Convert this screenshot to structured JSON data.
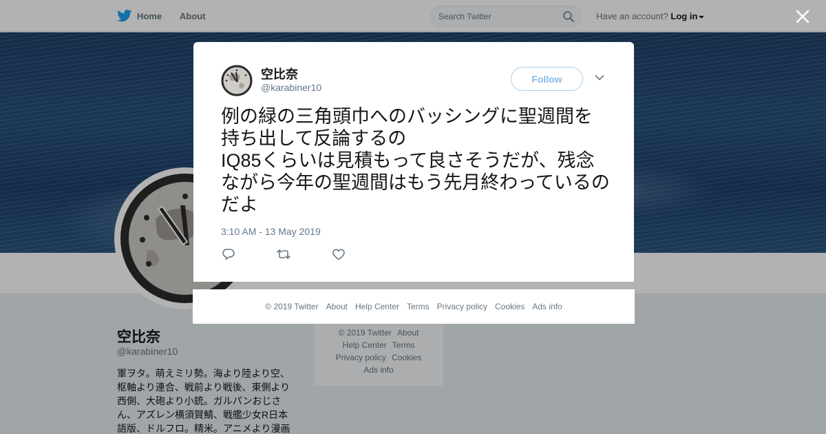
{
  "topbar": {
    "home_label": "Home",
    "about_label": "About",
    "search_placeholder": "Search Twitter",
    "account_prompt": "Have an account?",
    "login_label": "Log in"
  },
  "profile": {
    "name": "空比奈",
    "handle": "@karabiner10",
    "bio": "軍ヲタ。萌えミリ勢。海より陸より空、枢軸より連合、戦前より戦後、東側より西側、大砲より小銃。ガルパンおじさん、アズレン横須賀鯖、戦艦少女R日本語版、ドルフロ。精米。アニメより漫画"
  },
  "side_footer": {
    "row1": [
      "© 2019 Twitter",
      "About"
    ],
    "row2": [
      "Help Center",
      "Terms"
    ],
    "row3": [
      "Privacy policy",
      "Cookies"
    ],
    "row4": [
      "Ads info"
    ]
  },
  "tweet": {
    "author_name": "空比奈",
    "author_handle": "@karabiner10",
    "follow_label": "Follow",
    "text": "例の緑の三角頭巾へのバッシングに聖週間を持ち出して反論するの\nIQ85くらいは見積もって良さそうだが、残念ながら今年の聖週間はもう先月終わっているのだよ",
    "timestamp": "3:10 AM - 13 May 2019"
  },
  "modal_footer": {
    "links": [
      "© 2019 Twitter",
      "About",
      "Help Center",
      "Terms",
      "Privacy policy",
      "Cookies",
      "Ads info"
    ]
  },
  "colors": {
    "twitter_blue": "#1da1f2",
    "follow_border": "#a7d1ef",
    "follow_text": "#86bbe9"
  },
  "icons": [
    "twitter-bird-icon",
    "search-icon",
    "caret-down-icon",
    "close-icon",
    "chevron-down-icon",
    "reply-icon",
    "retweet-icon",
    "like-icon",
    "clock-avatar-icon"
  ]
}
